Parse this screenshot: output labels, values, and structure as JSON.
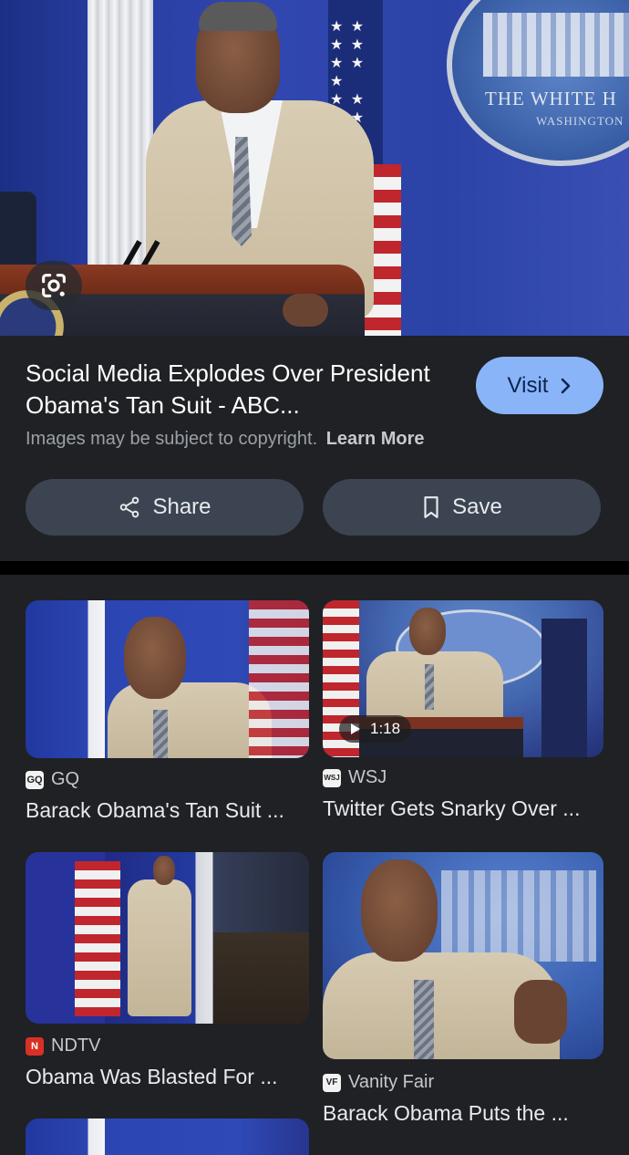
{
  "hero": {
    "seal_text": "THE WHITE H",
    "seal_subtext": "WASHINGTON",
    "lens_icon": "google-lens-icon"
  },
  "result": {
    "title": "Social Media Explodes Over President Obama's Tan Suit - ABC...",
    "visit_label": "Visit",
    "copyright_text": "Images may be subject to copyright.",
    "learn_more": "Learn More",
    "share_label": "Share",
    "save_label": "Save"
  },
  "related": [
    {
      "source": "GQ",
      "title": "Barack Obama's Tan Suit ...",
      "favicon_text": "GQ",
      "favicon_color": "#f2f2f2"
    },
    {
      "source": "WSJ",
      "title": "Twitter Gets Snarky Over ...",
      "favicon_text": "WSJ",
      "favicon_color": "#f2f2f2",
      "video_duration": "1:18"
    },
    {
      "source": "NDTV",
      "title": "Obama Was Blasted For ...",
      "favicon_text": "N",
      "favicon_color": "#d93025"
    },
    {
      "source": "Vanity Fair",
      "title": "Barack Obama Puts the ...",
      "favicon_text": "VF",
      "favicon_color": "#f2f2f2"
    }
  ],
  "colors": {
    "background": "#1f2125",
    "visit_button": "#8ab4f8",
    "action_button": "#3c4452"
  }
}
